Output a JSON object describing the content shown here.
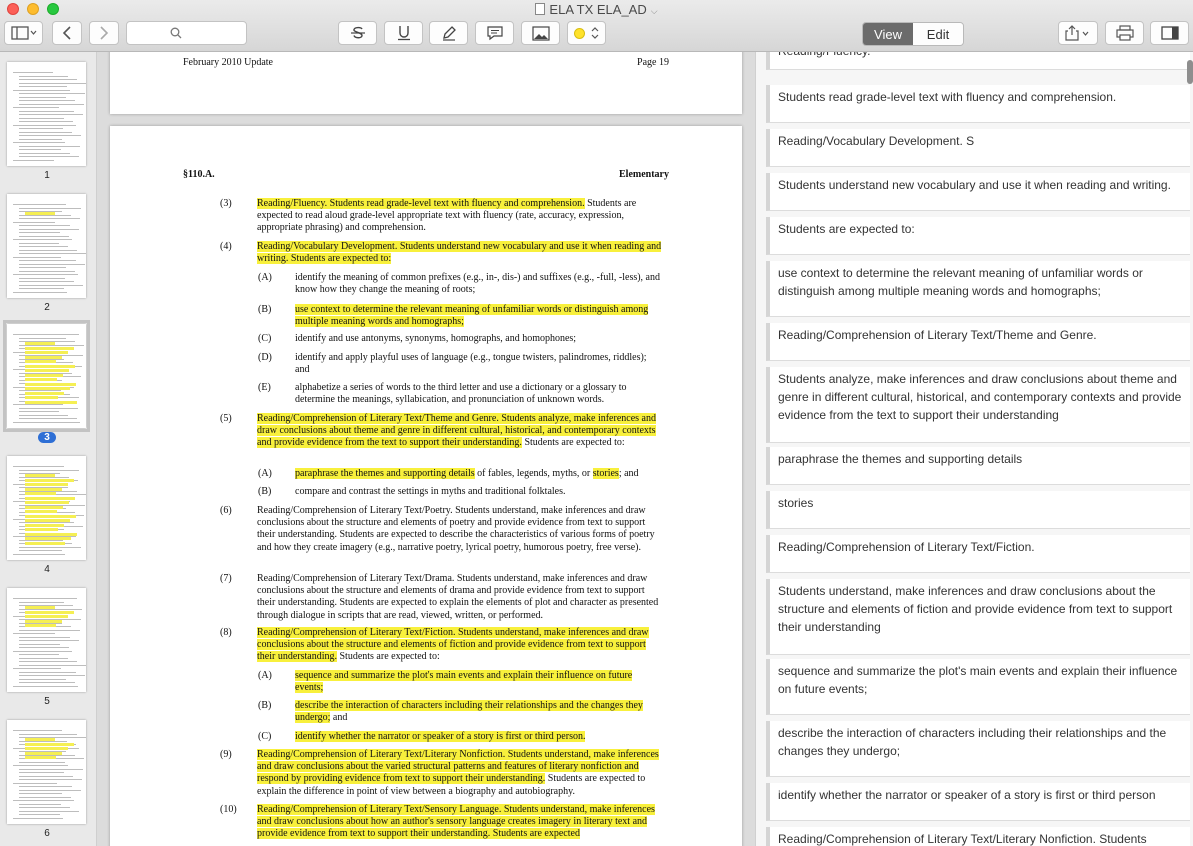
{
  "window": {
    "title": "ELA TX ELA_AD"
  },
  "toolbar": {
    "view_label": "View",
    "edit_label": "Edit",
    "icons": [
      "sidebar-toggle-icon",
      "back-arrow-icon",
      "forward-arrow-icon",
      "search-icon",
      "strikethrough-icon",
      "underline-icon",
      "pen-icon",
      "note-bubble-icon",
      "image-icon",
      "highlight-color-icon",
      "share-icon",
      "print-icon",
      "annotation-panel-icon"
    ],
    "highlight_color": "#ffe22b"
  },
  "sidebar": {
    "thumbs": [
      {
        "num": "1"
      },
      {
        "num": "2"
      },
      {
        "num": "3",
        "selected": true
      },
      {
        "num": "4"
      },
      {
        "num": "5"
      },
      {
        "num": "6"
      }
    ]
  },
  "document": {
    "page1": {
      "header_left": "February 2010 Update",
      "header_right": "Page 19"
    },
    "page2": {
      "section": "§110.A.",
      "level": "Elementary",
      "items": [
        {
          "n": "(3)",
          "t1": "Reading/Fluency. Students read grade-level text with fluency and comprehension.",
          "t2": " Students are expected to read aloud grade-level appropriate text with fluency (rate, accuracy, expression, appropriate phrasing) and comprehension."
        },
        {
          "n": "(4)",
          "t1": "Reading/Vocabulary Development. Students understand new vocabulary and use it when reading and writing. Students are expected to:",
          "t2": ""
        },
        {
          "n": "(A)",
          "t1": "",
          "t2": "identify the meaning of common prefixes (e.g., in-, dis-) and suffixes (e.g., -full, -less), and know how they change the meaning of roots;"
        },
        {
          "n": "(B)",
          "t1": "use context to determine the relevant meaning of unfamiliar words or distinguish among multiple meaning words and homographs;",
          "t2": ""
        },
        {
          "n": "(C)",
          "t1": "",
          "t2": "identify and use antonyms, synonyms, homographs, and homophones;"
        },
        {
          "n": "(D)",
          "t1": "",
          "t2": "identify and apply playful uses of language (e.g., tongue twisters, palindromes, riddles); and"
        },
        {
          "n": "(E)",
          "t1": "",
          "t2": "alphabetize a series of words to the third letter and use a dictionary or a glossary to determine the meanings, syllabication, and pronunciation of unknown words."
        },
        {
          "n": "(5)",
          "t1": "Reading/Comprehension of Literary Text/Theme and Genre. Students analyze, make inferences and draw conclusions about theme and genre in different cultural, historical, and contemporary contexts and provide evidence from the text to support their understanding.",
          "t2": " Students are expected to:"
        },
        {
          "n": "(A)",
          "t1": "paraphrase the themes and supporting details",
          "t2": " of fables, legends, myths, or ",
          "t3": "stories",
          "t4": "; and"
        },
        {
          "n": "(B)",
          "t1": "",
          "t2": "compare and contrast the settings in myths and traditional folktales."
        },
        {
          "n": "(6)",
          "t1": "",
          "t2": "Reading/Comprehension of Literary Text/Poetry. Students understand, make inferences and draw conclusions about the structure and elements of poetry and provide evidence from text to support their understanding. Students are expected to describe the characteristics of various forms of poetry and how they create imagery (e.g., narrative poetry, lyrical poetry, humorous poetry, free verse)."
        },
        {
          "n": "(7)",
          "t1": "",
          "t2": "Reading/Comprehension of Literary Text/Drama. Students understand, make inferences and draw conclusions about the structure and elements of drama and provide evidence from text to support their understanding. Students are expected to explain the elements of plot and character as presented through dialogue in scripts that are read, viewed, written, or performed."
        },
        {
          "n": "(8)",
          "t1": "Reading/Comprehension of Literary Text/Fiction. Students understand, make inferences and draw conclusions about the structure and elements of fiction and provide evidence from text to support their understanding.",
          "t2": " Students are expected to:"
        },
        {
          "n": "(A)",
          "t1": "sequence and summarize the plot's main events and explain their influence on future events;",
          "t2": ""
        },
        {
          "n": "(B)",
          "t1": "describe the interaction of characters including their relationships and the changes they undergo;",
          "t2": " and"
        },
        {
          "n": "(C)",
          "t1": "identify whether the narrator or speaker of a story is first or third person.",
          "t2": ""
        },
        {
          "n": "(9)",
          "t1": "Reading/Comprehension of Literary Text/Literary Nonfiction. Students understand, make inferences and draw conclusions about the varied structural patterns and features of literary nonfiction and respond by providing evidence from text to support their understanding.",
          "t2": " Students are expected to explain the difference in point of view between a biography and autobiography."
        },
        {
          "n": "(10)",
          "t1": "Reading/Comprehension of Literary Text/Sensory Language. Students understand, make inferences and draw conclusions about how an author's sensory language creates imagery in literary text and provide evidence from text to support their understanding. Students are expected",
          "t2": ""
        }
      ]
    }
  },
  "notes": [
    {
      "text": "Reading/Fluency."
    },
    {
      "text": "Students read grade-level text with fluency and comprehension."
    },
    {
      "text": "Reading/Vocabulary Development. S"
    },
    {
      "text": "Students understand new vocabulary and use it when reading and writing."
    },
    {
      "text": "Students are expected to:"
    },
    {
      "text": "use context to determine the relevant meaning of unfamiliar words or distinguish among multiple meaning words and homographs;"
    },
    {
      "text": "Reading/Comprehension of Literary Text/Theme and Genre."
    },
    {
      "text": "Students analyze, make inferences and draw conclusions about theme and genre in different cultural, historical, and contemporary contexts and provide evidence from the text to support their understanding"
    },
    {
      "text": "paraphrase the themes and supporting details"
    },
    {
      "text": "stories"
    },
    {
      "text": "Reading/Comprehension of Literary Text/Fiction."
    },
    {
      "text": "Students understand, make inferences and draw conclusions about the structure and elements of fiction and provide evidence from text to support their understanding"
    },
    {
      "text": "sequence and summarize the plot's main events and explain their influence on future events;"
    },
    {
      "text": "describe the interaction of characters including their relationships and the changes they undergo;"
    },
    {
      "text": "identify whether the narrator or speaker of a story is first or third person"
    },
    {
      "text": "Reading/Comprehension of Literary Text/Literary Nonfiction. Students"
    }
  ]
}
